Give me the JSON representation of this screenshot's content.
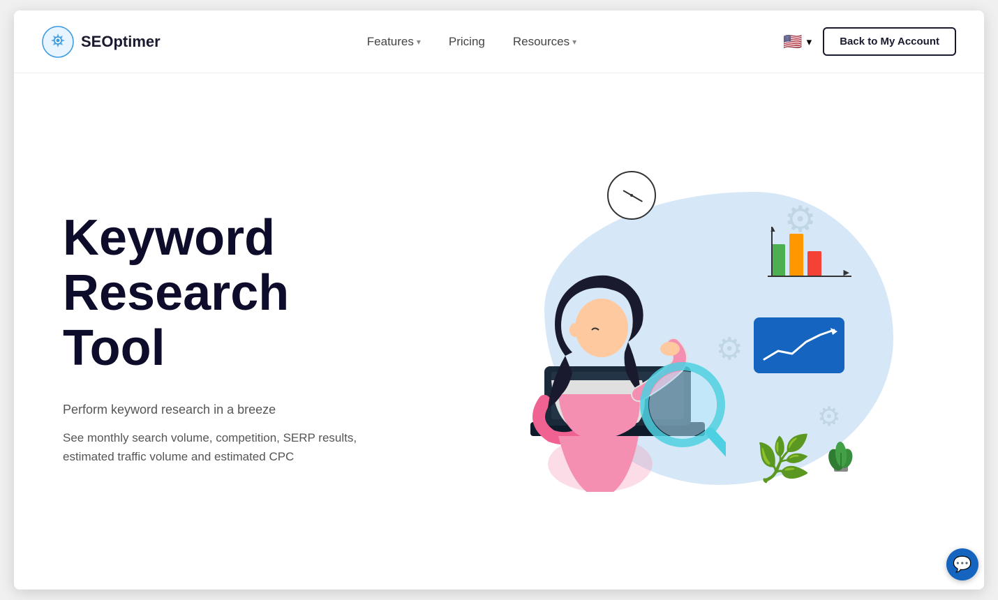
{
  "nav": {
    "logo_text": "SEOptimer",
    "links": [
      {
        "label": "Features",
        "has_dropdown": true
      },
      {
        "label": "Pricing",
        "has_dropdown": false
      },
      {
        "label": "Resources",
        "has_dropdown": true
      }
    ],
    "back_button": "Back to My Account",
    "flag_emoji": "🇺🇸"
  },
  "hero": {
    "title_line1": "Keyword",
    "title_line2": "Research",
    "title_line3": "Tool",
    "subtitle": "Perform keyword research in a breeze",
    "description": "See monthly search volume, competition, SERP results, estimated traffic volume and estimated CPC"
  },
  "chat": {
    "icon": "💬"
  }
}
